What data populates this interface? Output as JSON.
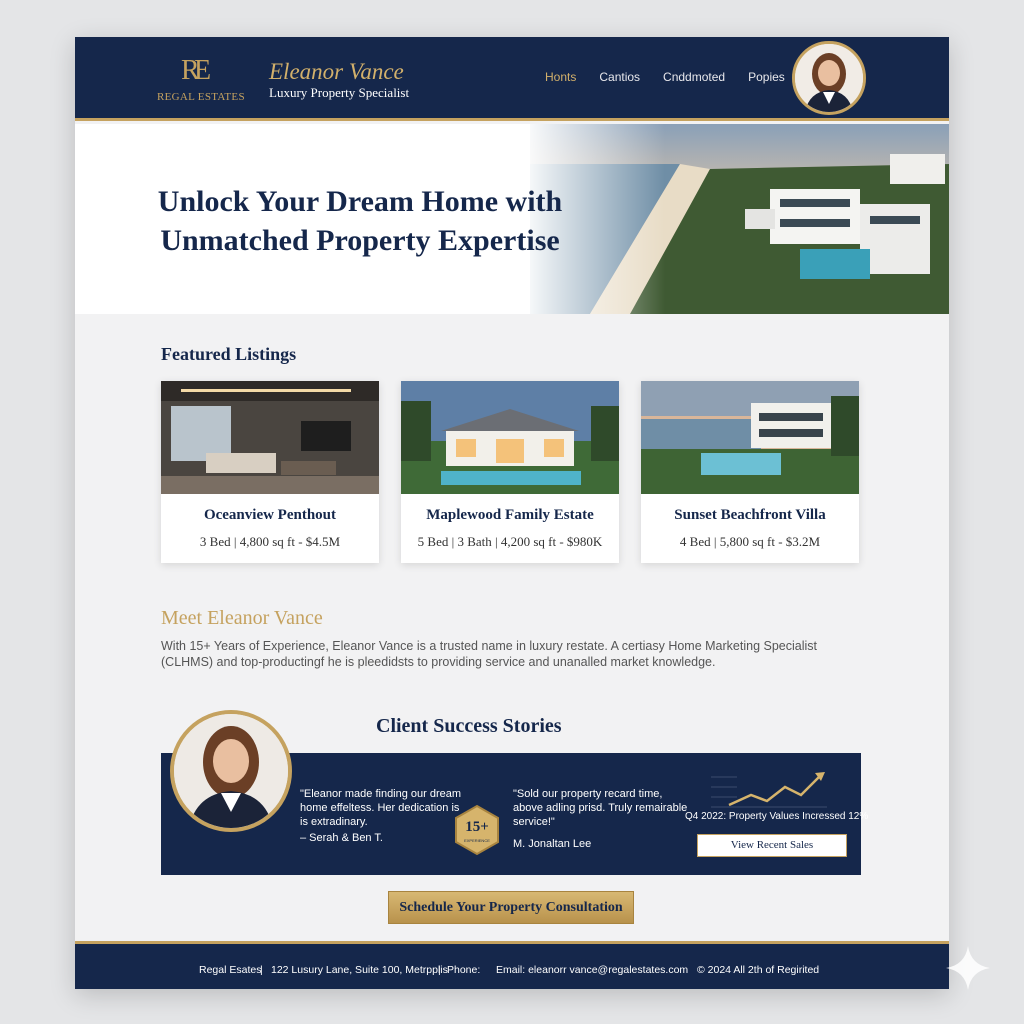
{
  "header": {
    "logo_text": "REGAL ESTATES",
    "agent_name": "Eleanor Vance",
    "agent_title": "Luxury Property Specialist",
    "nav": [
      "Honts",
      "Cantios",
      "Cnddmoted",
      "Popies"
    ]
  },
  "hero": {
    "title_line1": "Unlock Your Dream Home with",
    "title_line2": "Unmatched Property Expertise"
  },
  "featured": {
    "heading": "Featured Listings",
    "listings": [
      {
        "title": "Oceanview Penthout",
        "meta": "3 Bed | 4,800 sq ft - $4.5M"
      },
      {
        "title": "Maplewood Family Estate",
        "meta": "5 Bed | 3 Bath | 4,200 sq ft - $980K"
      },
      {
        "title": "Sunset Beachfront Villa",
        "meta": "4 Bed | 5,800 sq ft - $3.2M"
      }
    ]
  },
  "meet": {
    "heading": "Meet Eleanor Vance",
    "body": "With 15+ Years of Experience, Eleanor Vance is a trusted name in luxury restate. A certiasy Home Marketing Specialist (CLHMS) and top-productingf he is pleedidsts to providing service and unanalled market knowledge."
  },
  "stories": {
    "heading": "Client Success Stories",
    "quote1": "\"Eleanor made finding our dream home effeltess. Her dedication is is extradinary.",
    "quote1_by": "– Serah & Ben T.",
    "badge_number": "15+",
    "badge_sub": "EXPERIENCE",
    "quote2": "\"Sold our property recard time, above adling prisd. Truly remairable service!\"",
    "quote2_by": "M. Jonaltan Lee",
    "trend_label": "Q4 2022: Property Values Incressed 12%",
    "button": "View Recent Sales"
  },
  "cta": "Schedule Your Property Consultation",
  "footer": {
    "company": "Regal Esates",
    "address": "122 Lusury Lane, Suite 100, Metrpplis",
    "phone": "Phone:",
    "email": "Email: eleanorr vance@regalestates.com",
    "copyright": "© 2024 All 2th of Regirited"
  },
  "colors": {
    "navy": "#15274b",
    "gold": "#c5a25f",
    "background": "#f2f2f3"
  }
}
